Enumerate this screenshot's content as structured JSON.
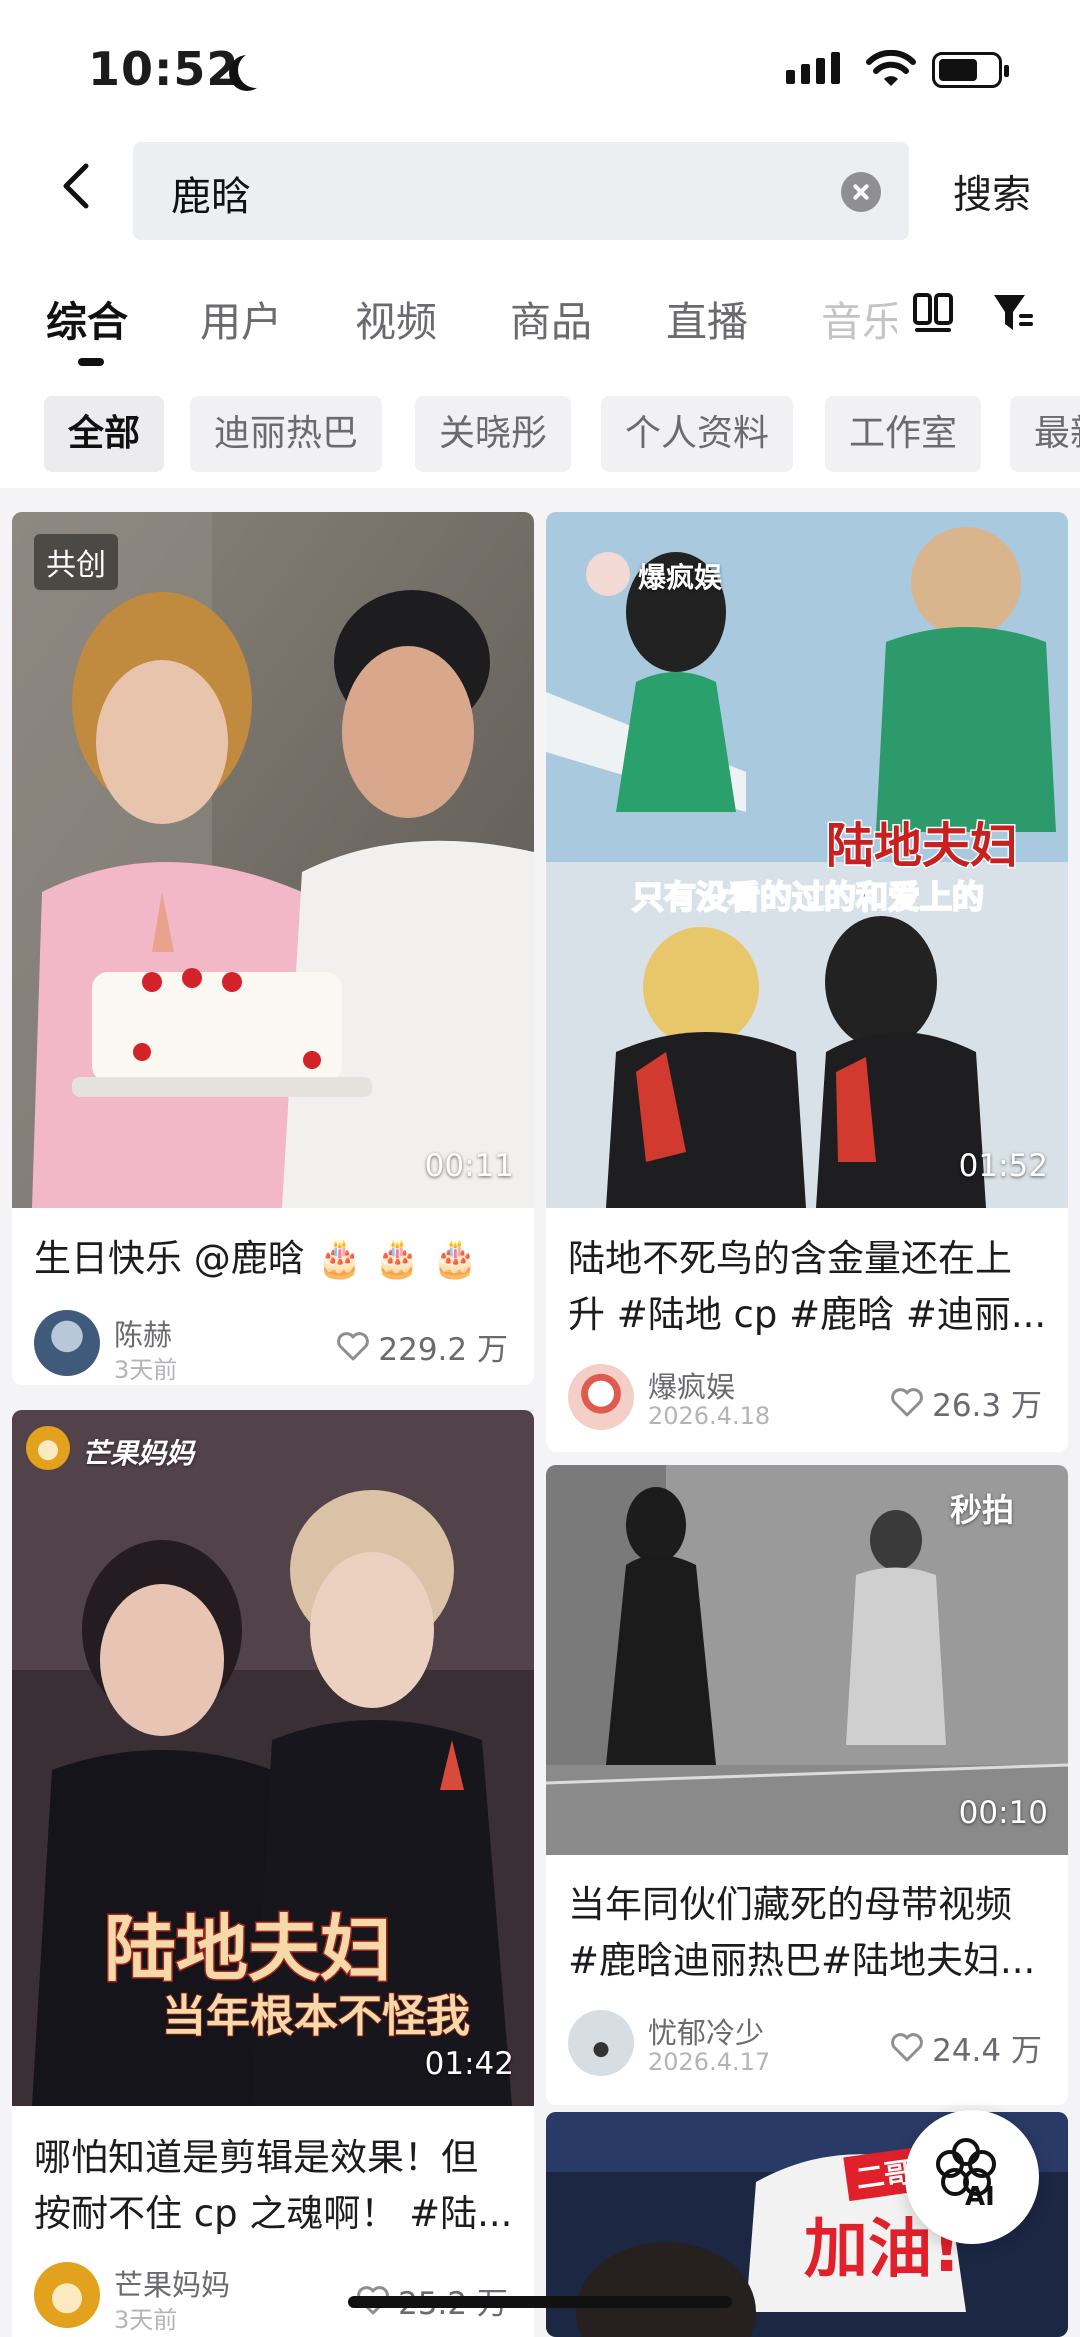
{
  "status_bar": {
    "time": "10:52"
  },
  "search": {
    "query": "鹿晗",
    "submit_label": "搜索"
  },
  "tabs": [
    {
      "label": "综合",
      "active": true
    },
    {
      "label": "用户"
    },
    {
      "label": "视频"
    },
    {
      "label": "商品"
    },
    {
      "label": "直播"
    },
    {
      "label": "音乐"
    }
  ],
  "chips": [
    "全部",
    "迪丽热巴",
    "关晓彤",
    "个人资料",
    "工作室",
    "最新"
  ],
  "cards": [
    {
      "badge": "共创",
      "duration": "00:11",
      "title": "生日快乐 @鹿晗 🎂 🎂 🎂",
      "author": "陈赫",
      "date": "3天前",
      "likes": "229.2 万"
    },
    {
      "watermark": "爆疯娱",
      "overlay_title": "陆地夫妇",
      "overlay_subtitle": "只有没看的过的和爱上的",
      "duration": "01:52",
      "title": "陆地不死鸟的含金量还在上升 #陆地 cp #鹿晗 #迪丽...",
      "author": "爆疯娱",
      "date": "2026.4.18",
      "likes": "26.3 万"
    },
    {
      "watermark": "芒果妈妈",
      "overlay_title": "陆地夫妇",
      "overlay_subtitle": "当年根本不怪我",
      "duration": "01:42",
      "title": "哪怕知道是剪辑是效果！但按耐不住 cp 之魂啊！ #陆...",
      "author": "芒果妈妈",
      "date": "3天前",
      "likes": "25.2 万"
    },
    {
      "watermark": "秒拍",
      "duration": "00:10",
      "title": "当年同伙们藏死的母带视频 #鹿晗迪丽热巴#陆地夫妇...",
      "author": "忧郁冷少",
      "date": "2026.4.17",
      "likes": "24.4 万"
    },
    {
      "overlay_title": "加油!",
      "overlay_subtitle": "二哥"
    }
  ],
  "fab": {
    "label": "AI"
  },
  "icons": [
    "back-icon",
    "clear-icon",
    "grid-view-icon",
    "filter-icon",
    "heart-icon",
    "moon-icon",
    "signal-icon",
    "wifi-icon",
    "battery-icon"
  ]
}
